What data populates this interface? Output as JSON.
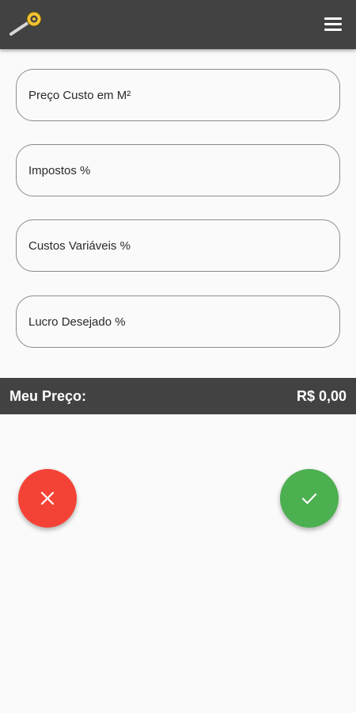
{
  "header": {
    "logo_icon": "tape-measure-icon",
    "menu_icon": "hamburger-menu-icon"
  },
  "form": {
    "fields": [
      {
        "placeholder": "Preço Custo em M²",
        "value": ""
      },
      {
        "placeholder": "Impostos %",
        "value": ""
      },
      {
        "placeholder": "Custos Variáveis %",
        "value": ""
      },
      {
        "placeholder": "Lucro Desejado %",
        "value": ""
      }
    ]
  },
  "result": {
    "label": "Meu Preço:",
    "value": "R$ 0,00"
  },
  "actions": {
    "cancel_icon": "close-icon",
    "confirm_icon": "check-icon"
  },
  "colors": {
    "bar": "#424242",
    "cancel": "#f44336",
    "confirm": "#4caf50",
    "background": "#fafafa"
  }
}
